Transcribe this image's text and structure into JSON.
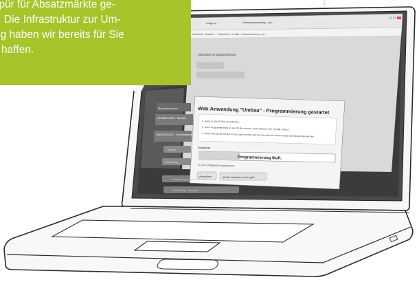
{
  "callout": {
    "line1": "espür für Absatzmärkte ge-",
    "line2": "Die Infrastruktur zur Um-",
    "line3": "ng haben wir bereits für Sie",
    "line4": "haffen."
  },
  "browser": {
    "tab_label": "Umbauanwendung - abc",
    "bookmarks": "Kleinarbeit · Reiseinfo... ·  Deutschland ·  Kontakt · Umbauanwendung - abc"
  },
  "background_app": {
    "heading": "Startseite ist abgeschlossen",
    "list_header": "Materialnummer",
    "list_items": [
      {
        "num": "1",
        "text": "2014568715021 · Blindteil"
      },
      {
        "num": "2",
        "text": "7662519072421 · Schnellwechsel 0...."
      }
    ],
    "side_buttons": [
      "Umbau",
      "Einrichtung",
      "Qt...",
      "Progr..."
    ],
    "bottom_buttons": [
      "Fertigmeldung - Standard",
      "Einrichtung - Standard"
    ]
  },
  "dialog": {
    "title": "Web-Anwendung \"Umbau\" - Programmierung gestartet",
    "steps": [
      "1. Gerät an die dS-Box anschließen.",
      "2. Dann Programmierung an der dS-Box starten, durch Drücken des \"Config Tasters\".",
      "3. Warten Sie, bis die dS-Box rot bzw. gelb leuchtet oder grün leuchtet und diese Anzeige automatisch beendet wird."
    ],
    "progress_label": "Fortschritt",
    "progress_text": "Programmierung läuft.",
    "progress_fraction": 0.3,
    "progress_sub": "0 von 2 erfolgreich programmiert",
    "cancel_label": "Abbrechen",
    "confirm_label": "dS-Box leuchtet rot oder gelb"
  }
}
